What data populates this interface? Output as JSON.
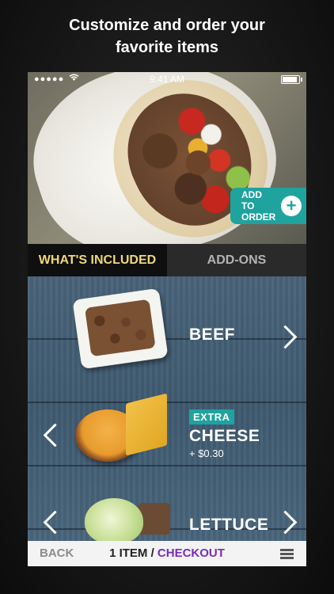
{
  "headline": {
    "line1": "Customize and order your",
    "line2": "favorite items"
  },
  "statusbar": {
    "signal": "●●●●●",
    "time": "9:41 AM"
  },
  "hero": {
    "add_button_label": "ADD TO ORDER",
    "add_button_icon": "plus-circle-icon"
  },
  "tabs": [
    {
      "label": "WHAT'S INCLUDED",
      "active": true
    },
    {
      "label": "ADD-ONS",
      "active": false
    }
  ],
  "items": [
    {
      "name": "BEEF",
      "badge": "",
      "price": ""
    },
    {
      "name": "CHEESE",
      "badge": "EXTRA",
      "price": "+ $0.30"
    },
    {
      "name": "LETTUCE",
      "badge": "",
      "price": ""
    }
  ],
  "bottombar": {
    "back": "BACK",
    "count": "1 ITEM",
    "separator": " / ",
    "checkout": "CHECKOUT",
    "menu_icon": "hamburger-menu-icon"
  },
  "colors": {
    "accent_teal": "#1fa39e",
    "checkout_purple": "#7a2bb7",
    "active_tab_text": "#f0d77a"
  }
}
